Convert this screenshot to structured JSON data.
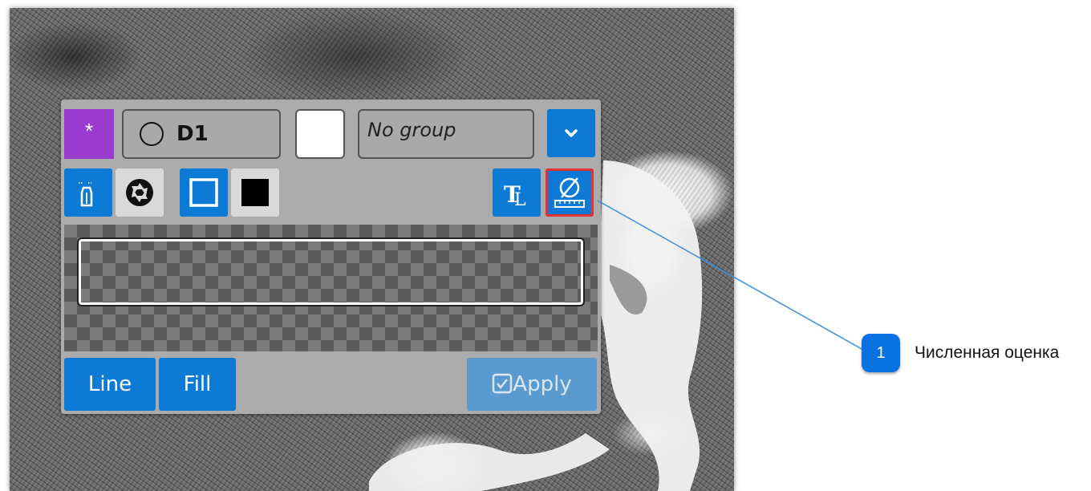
{
  "panel": {
    "star_label": "*",
    "shape_name": "D1",
    "group_placeholder": "No group",
    "line_label": "Line",
    "fill_label": "Fill",
    "apply_label": "Apply"
  },
  "callout": {
    "number": "1",
    "text": "Численная оценка"
  },
  "colors": {
    "accent_blue": "#0d7ad6",
    "star_purple": "#9a3ccf",
    "highlight_red": "#e53030",
    "badge_blue": "#0a72e0"
  },
  "icons": [
    "star-icon",
    "circle-shape-icon",
    "chevron-down-icon",
    "pencil-icon",
    "aperture-icon",
    "outline-square-icon",
    "filled-square-icon",
    "text-tool-icon",
    "measure-icon",
    "checkbox-icon"
  ]
}
